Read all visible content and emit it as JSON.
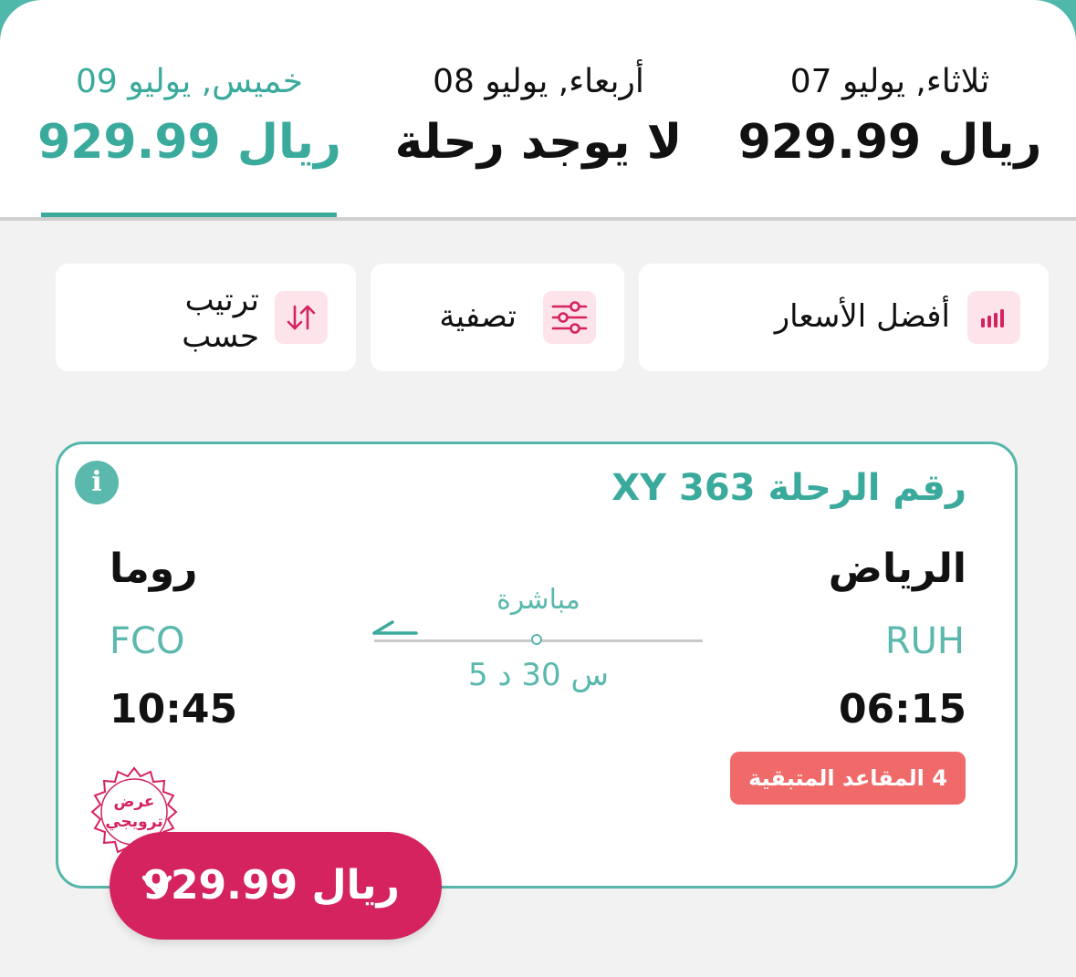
{
  "date_tabs": [
    {
      "label": "ثلاثاء, يوليو 07",
      "price": "929.99 ريال",
      "selected": false
    },
    {
      "label": "أربعاء, يوليو 08",
      "price": "لا يوجد رحلة",
      "selected": false
    },
    {
      "label": "خميس, يوليو 09",
      "price": "929.99 ريال",
      "selected": true
    }
  ],
  "filters": {
    "best_prices_label": "أفضل الأسعار",
    "filter_label": "تصفية",
    "sort_label_line1": "ترتيب",
    "sort_label_line2": "حسب"
  },
  "flight": {
    "flight_number": "رقم الرحلة XY 363",
    "origin_city": "الرياض",
    "origin_code": "RUH",
    "departure_time": "06:15",
    "destination_city": "روما",
    "destination_code": "FCO",
    "arrival_time": "10:45",
    "stop_type": "مباشرة",
    "duration": "5 س 30 د",
    "seats_left": "4 المقاعد المتبقية",
    "promo_label_line1": "عرض",
    "promo_label_line2": "ترويجي",
    "price": "929.99 ريال"
  },
  "colors": {
    "teal": "#3aaa9c",
    "pink": "#d4235f",
    "badge_red": "#f06a6a",
    "icon_bg": "#fde3ea"
  },
  "icons": {
    "info": "info-icon",
    "best_prices": "bar-chart-icon",
    "filter": "sliders-icon",
    "sort": "sort-arrows-icon",
    "route": "arrow-left-icon",
    "price_toggle": "chevron-down-icon"
  }
}
